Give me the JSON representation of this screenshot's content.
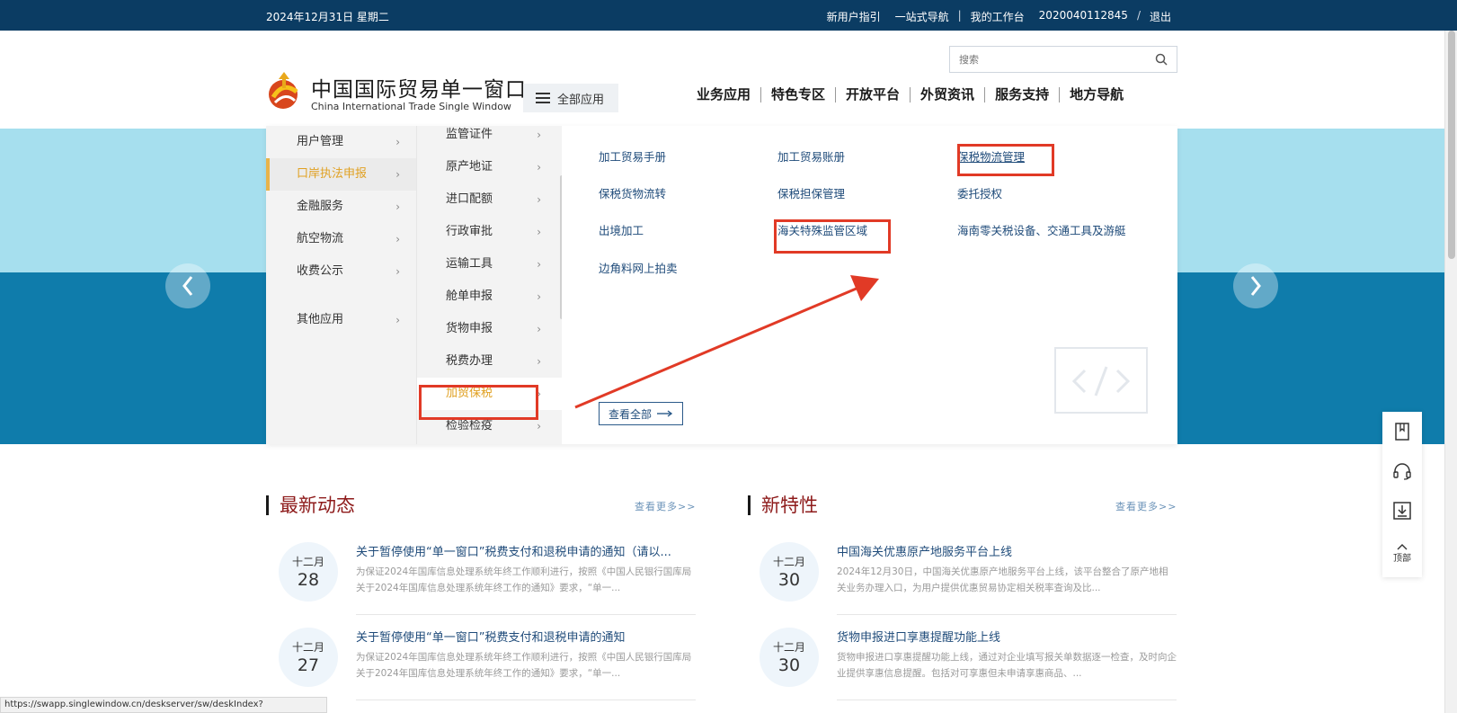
{
  "topbar": {
    "date": "2024年12月31日 星期二",
    "links": [
      "新用户指引",
      "一站式导航",
      "我的工作台",
      "2020040112845",
      "/",
      "退出"
    ]
  },
  "header": {
    "search_placeholder": "搜索",
    "logo_title": "中国国际贸易单一窗口",
    "logo_subtitle": "China International Trade Single Window",
    "all_apps": "全部应用",
    "nav": [
      "业务应用",
      "特色专区",
      "开放平台",
      "外贸资讯",
      "服务支持",
      "地方导航"
    ]
  },
  "menu": {
    "col1": [
      {
        "label": "用户管理",
        "active": false
      },
      {
        "label": "口岸执法申报",
        "active": true
      },
      {
        "label": "金融服务",
        "active": false
      },
      {
        "label": "航空物流",
        "active": false
      },
      {
        "label": "收费公示",
        "active": false
      },
      {
        "label": "其他应用",
        "active": false
      }
    ],
    "col2": [
      {
        "label": "监管证件",
        "active": false
      },
      {
        "label": "原产地证",
        "active": false
      },
      {
        "label": "进口配额",
        "active": false
      },
      {
        "label": "行政审批",
        "active": false
      },
      {
        "label": "运输工具",
        "active": false
      },
      {
        "label": "舱单申报",
        "active": false
      },
      {
        "label": "货物申报",
        "active": false
      },
      {
        "label": "税费办理",
        "active": false
      },
      {
        "label": "加贸保税",
        "active": true
      },
      {
        "label": "检验检疫",
        "active": false
      }
    ],
    "col3": [
      "加工贸易手册",
      "加工贸易账册",
      "保税物流管理",
      "保税货物流转",
      "保税担保管理",
      "委托授权",
      "出境加工",
      "海关特殊监管区域",
      "海南零关税设备、交通工具及游艇",
      "边角料网上拍卖"
    ],
    "view_all": "查看全部"
  },
  "news": {
    "heading": "最新动态",
    "more": "查看更多>>",
    "items": [
      {
        "month": "十二月",
        "day": "28",
        "title": "关于暂停使用“单一窗口”税费支付和退税申请的通知（请以...",
        "desc": "为保证2024年国库信息处理系统年终工作顺利进行，按照《中国人民银行国库局关于2024年国库信息处理系统年终工作的通知》要求，“单一..."
      },
      {
        "month": "十二月",
        "day": "27",
        "title": "关于暂停使用“单一窗口”税费支付和退税申请的通知",
        "desc": "为保证2024年国库信息处理系统年终工作顺利进行，按照《中国人民银行国库局关于2024年国库信息处理系统年终工作的通知》要求，“单一..."
      }
    ]
  },
  "features": {
    "heading": "新特性",
    "more": "查看更多>>",
    "items": [
      {
        "month": "十二月",
        "day": "30",
        "title": "中国海关优惠原产地服务平台上线",
        "desc": "2024年12月30日，中国海关优惠原产地服务平台上线，该平台整合了原产地相关业务办理入口，为用户提供优惠贸易协定相关税率查询及比..."
      },
      {
        "month": "十二月",
        "day": "30",
        "title": "货物申报进口享惠提醒功能上线",
        "desc": "货物申报进口享惠提醒功能上线，通过对企业填写报关单数据逐一检查，及时向企业提供享惠信息提醒。包括对可享惠但未申请享惠商品、..."
      }
    ]
  },
  "sidetools": {
    "top_label": "顶部"
  },
  "statusbar": {
    "url": "https://swapp.singlewindow.cn/deskserver/sw/deskIndex?menu_id=bws"
  },
  "colors": {
    "topbar": "#0b3c63",
    "accent_red": "#e13a26",
    "active_gold": "#e0a021",
    "banner_light": "#a6dfee",
    "banner_dark": "#0f7cab"
  }
}
